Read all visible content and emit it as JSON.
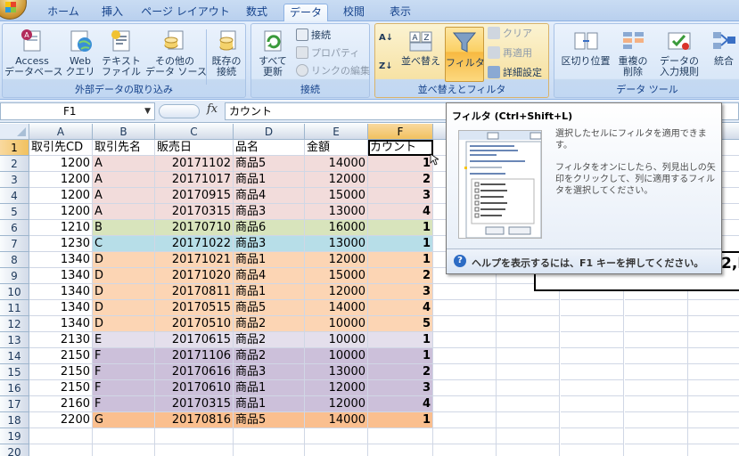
{
  "tabs": [
    {
      "label": "ホーム",
      "active": false
    },
    {
      "label": "挿入",
      "active": false
    },
    {
      "label": "ページ レイアウト",
      "active": false
    },
    {
      "label": "数式",
      "active": false
    },
    {
      "label": "データ",
      "active": true
    },
    {
      "label": "校閲",
      "active": false
    },
    {
      "label": "表示",
      "active": false
    }
  ],
  "ribbon": {
    "external_data": {
      "group_label": "外部データの取り込み",
      "access": "Access\nデータベース",
      "web": "Web\nクエリ",
      "text": "テキスト\nファイル",
      "other": "その他の\nデータ ソース",
      "existing": "既存の\n接続"
    },
    "connections": {
      "group_label": "接続",
      "refresh_all": "すべて\n更新",
      "connections": "接続",
      "properties": "プロパティ",
      "edit_links": "リンクの編集"
    },
    "sort_filter": {
      "group_label": "並べ替えとフィルタ",
      "sort": "並べ替え",
      "filter": "フィルタ",
      "clear": "クリア",
      "reapply": "再適用",
      "advanced": "詳細設定"
    },
    "data_tools": {
      "group_label": "データ ツール",
      "text_to_columns": "区切り位置",
      "remove_duplicates": "重複の\n削除",
      "validation": "データの\n入力規則",
      "consolidate": "統合"
    }
  },
  "formula_bar": {
    "name_box": "F1",
    "fx": "fx",
    "value": "カウント"
  },
  "sheet": {
    "columns": [
      "A",
      "B",
      "C",
      "D",
      "E",
      "F"
    ],
    "selected_column": "F",
    "selected_row": "1",
    "header_row": [
      "取引先CD",
      "取引先名",
      "販売日",
      "品名",
      "金額",
      "カウント"
    ],
    "rows": [
      {
        "n": "2",
        "cells": [
          "1200",
          "A",
          "20171102",
          "商品5",
          "14000",
          "1"
        ],
        "color": "#f2dcdb"
      },
      {
        "n": "3",
        "cells": [
          "1200",
          "A",
          "20171017",
          "商品1",
          "12000",
          "2"
        ],
        "color": "#f2dcdb"
      },
      {
        "n": "4",
        "cells": [
          "1200",
          "A",
          "20170915",
          "商品4",
          "15000",
          "3"
        ],
        "color": "#f2dcdb"
      },
      {
        "n": "5",
        "cells": [
          "1200",
          "A",
          "20170315",
          "商品3",
          "13000",
          "4"
        ],
        "color": "#f2dcdb"
      },
      {
        "n": "6",
        "cells": [
          "1210",
          "B",
          "20170710",
          "商品6",
          "16000",
          "1"
        ],
        "color": "#d8e4bc"
      },
      {
        "n": "7",
        "cells": [
          "1230",
          "C",
          "20171022",
          "商品3",
          "13000",
          "1"
        ],
        "color": "#b7dee8"
      },
      {
        "n": "8",
        "cells": [
          "1340",
          "D",
          "20171021",
          "商品1",
          "12000",
          "1"
        ],
        "color": "#fcd5b4"
      },
      {
        "n": "9",
        "cells": [
          "1340",
          "D",
          "20171020",
          "商品4",
          "15000",
          "2"
        ],
        "color": "#fcd5b4"
      },
      {
        "n": "10",
        "cells": [
          "1340",
          "D",
          "20170811",
          "商品1",
          "12000",
          "3"
        ],
        "color": "#fcd5b4"
      },
      {
        "n": "11",
        "cells": [
          "1340",
          "D",
          "20170515",
          "商品5",
          "14000",
          "4"
        ],
        "color": "#fcd5b4"
      },
      {
        "n": "12",
        "cells": [
          "1340",
          "D",
          "20170510",
          "商品2",
          "10000",
          "5"
        ],
        "color": "#fcd5b4"
      },
      {
        "n": "13",
        "cells": [
          "2130",
          "E",
          "20170615",
          "商品2",
          "10000",
          "1"
        ],
        "color": "#e4dfec"
      },
      {
        "n": "14",
        "cells": [
          "2150",
          "F",
          "20171106",
          "商品2",
          "10000",
          "1"
        ],
        "color": "#ccc0da"
      },
      {
        "n": "15",
        "cells": [
          "2150",
          "F",
          "20170616",
          "商品3",
          "13000",
          "2"
        ],
        "color": "#ccc0da"
      },
      {
        "n": "16",
        "cells": [
          "2150",
          "F",
          "20170610",
          "商品1",
          "12000",
          "3"
        ],
        "color": "#ccc0da"
      },
      {
        "n": "17",
        "cells": [
          "2160",
          "F",
          "20170315",
          "商品1",
          "12000",
          "4"
        ],
        "color": "#ccc0da"
      },
      {
        "n": "18",
        "cells": [
          "2200",
          "G",
          "20170816",
          "商品5",
          "14000",
          "1"
        ],
        "color": "#fabf8f"
      }
    ],
    "empty_rows": [
      "19",
      "20"
    ]
  },
  "tooltip": {
    "title": "フィルタ (Ctrl+Shift+L)",
    "desc1": "選択したセルにフィルタを適用できます。",
    "desc2": "フィルタをオンにしたら、列見出しの矢印をクリックして、列に適用するフィルタを選択してください。",
    "help": "ヘルプを表示するには、F1 キーを押してください。"
  },
  "behind_text": "2,I"
}
